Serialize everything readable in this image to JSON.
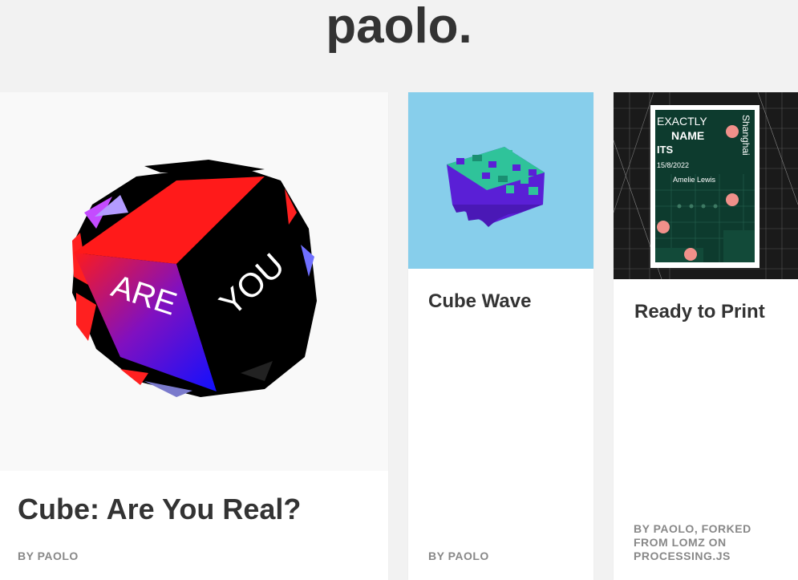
{
  "site": {
    "title": "paolo."
  },
  "cards": [
    {
      "title": "Cube: Are You Real?",
      "author": "BY PAOLO",
      "thumb_bg": "#f9f9f9",
      "cube_words": [
        "ARE",
        "YOU"
      ]
    },
    {
      "title": "Cube Wave",
      "author": "BY PAOLO",
      "thumb_bg": "#87ceeb"
    },
    {
      "title": "Ready to Print",
      "author": "BY PAOLO, FORKED FROM LOMZ ON PROCESSING.JS",
      "thumb_bg": "#1a1a1a",
      "poster": {
        "line1": "EXACTLY",
        "line2": "NAME",
        "line3": "ITS",
        "date": "15/8/2022",
        "person": "Amelie Lewis",
        "city": "Shanghai"
      }
    }
  ],
  "colors": {
    "page_bg": "#f2f2f2",
    "card_bg": "#ffffff",
    "title_text": "#333333",
    "author_text": "#888888",
    "cube_red": "#ff1a1a",
    "cube_blue": "#1010ff",
    "wave_teal": "#2fc39a",
    "wave_purple": "#5a1fd6",
    "poster_green": "#0d3b2e",
    "poster_dot": "#f0908a"
  }
}
